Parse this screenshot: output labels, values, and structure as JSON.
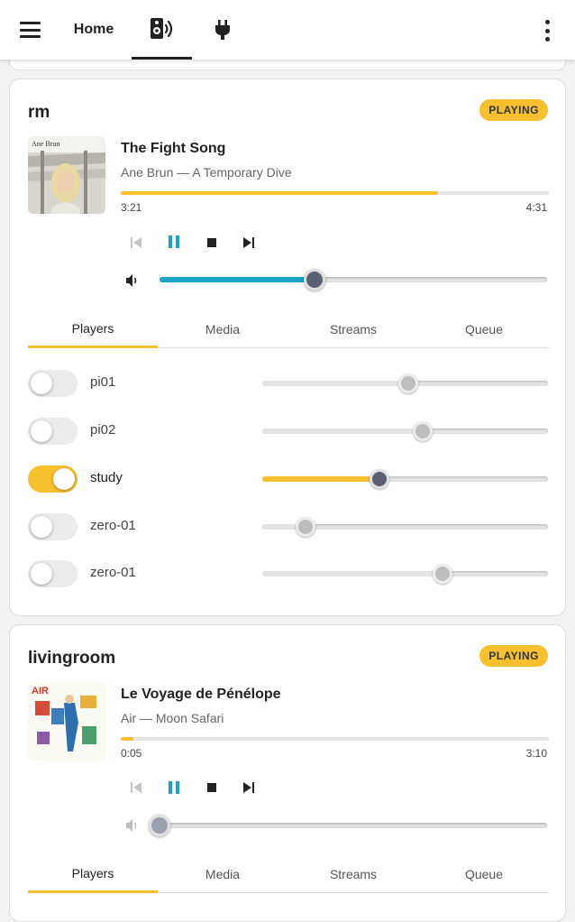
{
  "nav": {
    "home_label": "Home",
    "speaker_icon": "speaker-icon",
    "plug_icon": "plug-icon"
  },
  "groups": [
    {
      "name": "rm",
      "status": "PLAYING",
      "track": {
        "title": "The Fight Song",
        "subtitle": "Ane Brun — A Temporary Dive",
        "elapsed": "3:21",
        "duration": "4:31",
        "progress": 0.74
      },
      "album_text": "Ane Brun",
      "volume": 0.4,
      "tabs": [
        "Players",
        "Media",
        "Streams",
        "Queue"
      ],
      "active_tab": "Players",
      "players": [
        {
          "name": "pi01",
          "enabled": false,
          "volume": 0.51
        },
        {
          "name": "pi02",
          "enabled": false,
          "volume": 0.56
        },
        {
          "name": "study",
          "enabled": true,
          "volume": 0.41
        },
        {
          "name": "zero-01",
          "enabled": false,
          "volume": 0.15
        },
        {
          "name": "zero-01",
          "enabled": false,
          "volume": 0.63
        }
      ]
    },
    {
      "name": "livingroom",
      "status": "PLAYING",
      "track": {
        "title": "Le Voyage de Pénélope",
        "subtitle": "Air — Moon Safari",
        "elapsed": "0:05",
        "duration": "3:10",
        "progress": 0.03
      },
      "album_text": "AIR",
      "volume": 0.0,
      "tabs": [
        "Players",
        "Media",
        "Streams",
        "Queue"
      ],
      "active_tab": "Players"
    }
  ],
  "colors": {
    "accent": "#f6c02f",
    "volume": "#1aa3c7",
    "thumb": "#5b6170"
  }
}
